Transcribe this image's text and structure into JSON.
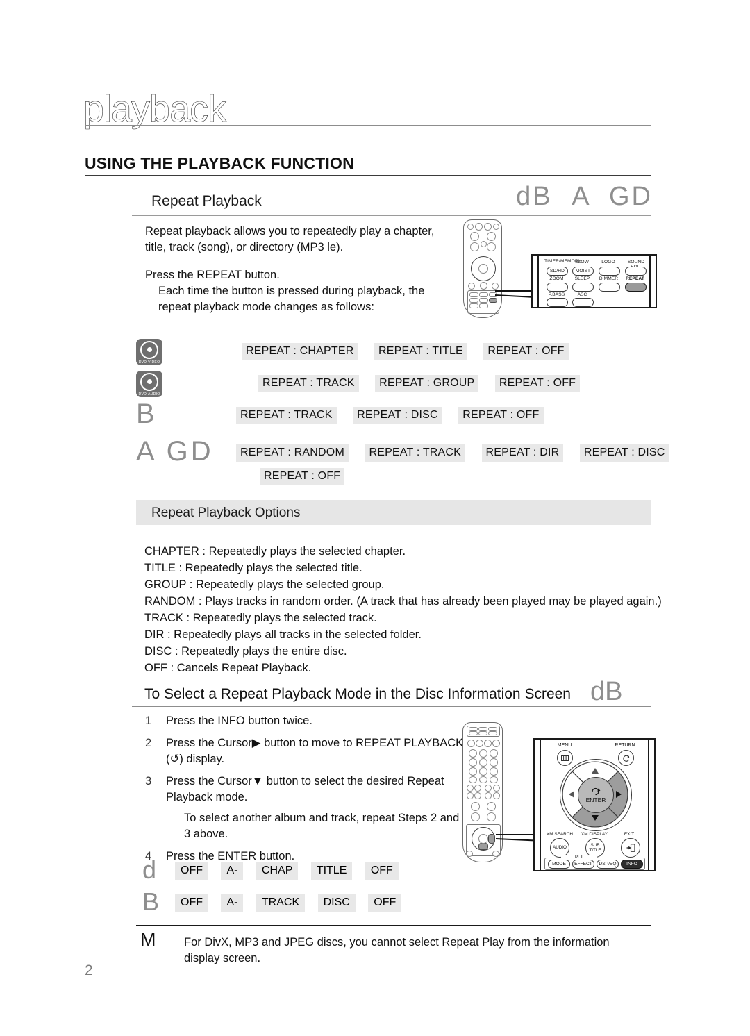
{
  "document": {
    "chapter_title": "playback",
    "section_heading": "USING THE PLAYBACK FUNCTION",
    "page_number": "2"
  },
  "repeat_playback": {
    "heading": "Repeat Playback",
    "disc_marks": [
      "dB",
      "A",
      "GD"
    ],
    "intro": "Repeat playback allows you to repeatedly play a chapter, title, track (song), or directory (MP3  le).",
    "press_line": "Press the REPEAT button.",
    "each_time": "Each time the button is pressed during playback, the repeat playback mode changes as follows:",
    "flows": [
      {
        "media_type": "disc-icon",
        "icon_label": "DVD-VIDEO",
        "steps": [
          "REPEAT : CHAPTER",
          "REPEAT : TITLE",
          "REPEAT : OFF"
        ],
        "steps_wrap": []
      },
      {
        "media_type": "disc-icon",
        "icon_label": "DVD-AUDIO",
        "steps": [
          "REPEAT : TRACK",
          "REPEAT : GROUP",
          "REPEAT : OFF"
        ],
        "steps_wrap": []
      },
      {
        "media_type": "glyph",
        "glyph": "B",
        "steps": [
          "REPEAT : TRACK",
          "REPEAT : DISC",
          "REPEAT : OFF"
        ],
        "steps_wrap": []
      },
      {
        "media_type": "glyph",
        "glyph": "A GD",
        "steps": [
          "REPEAT : RANDOM",
          "REPEAT : TRACK",
          "REPEAT : DIR",
          "REPEAT : DISC"
        ],
        "steps_wrap": [
          "REPEAT : OFF"
        ]
      }
    ]
  },
  "options": {
    "band_label": "Repeat Playback Options",
    "items": [
      "CHAPTER : Repeatedly plays the selected chapter.",
      "TITLE : Repeatedly plays the selected title.",
      "GROUP : Repeatedly plays the selected group.",
      "RANDOM : Plays tracks in random order. (A track that has already been played may be played again.)",
      "TRACK : Repeatedly plays the selected track.",
      "DIR : Repeatedly plays all tracks in the selected folder.",
      "DISC : Repeatedly plays the entire disc.",
      "OFF : Cancels Repeat Playback."
    ]
  },
  "disc_info_section": {
    "heading": "To Select a Repeat Playback Mode in the Disc Information Screen",
    "disc_mark": "dB",
    "steps": [
      {
        "num": "1",
        "text": "Press the INFO button twice."
      },
      {
        "num": "2",
        "text": "Press the Cursor▶ button to move to REPEAT PLAYBACK (↺) display."
      },
      {
        "num": "3",
        "text": "Press the Cursor▼ button to select the desired Repeat Playback mode."
      },
      {
        "num": "4",
        "text": "Press the ENTER button."
      }
    ],
    "substep": "To select another album and track, repeat Steps 2 and 3 above.",
    "mode_rows": [
      {
        "glyph": "d",
        "chips": [
          "OFF",
          "A-",
          "CHAP",
          "TITLE",
          "OFF"
        ]
      },
      {
        "glyph": "B",
        "chips": [
          "OFF",
          "A-",
          "TRACK",
          "DISC",
          "OFF"
        ]
      }
    ]
  },
  "note": {
    "icon": "M",
    "text": "For DivX, MP3 and JPEG discs, you cannot select Repeat Play from the information display screen."
  },
  "remote_top": {
    "labels_row1": [
      "TIMER/MEMORY",
      "SLOW",
      "LOGO",
      "SOUND EDIT"
    ],
    "buttons_row1": [
      "SD/HD",
      "MOIST",
      "",
      ""
    ],
    "labels_row2": [
      "ZOOM",
      "SLEEP",
      "DIMMER",
      "REPEAT"
    ],
    "labels_row3": [
      "P.BASS",
      "ASC"
    ],
    "highlighted": "REPEAT"
  },
  "remote_bottom": {
    "menu_label": "MENU",
    "return_label": "RETURN",
    "enter_label": "ENTER",
    "bottom_labels": [
      "XM SEARCH",
      "XM DISPLAY",
      "EXIT"
    ],
    "bottom_buttons": [
      "AUDIO",
      "SUB TITLE",
      ""
    ],
    "dpl_title": "PL II",
    "dpl_buttons": [
      "MODE",
      "EFFECT",
      "DSP/EQ",
      "INFO"
    ],
    "highlighted": "INFO"
  },
  "colors": {
    "chip_bg": "#e8e8e8",
    "band_bg": "#e6e6e6",
    "disc_icon_bg": "#6f6f6f",
    "glyph_gray": "#8e8e8e"
  }
}
